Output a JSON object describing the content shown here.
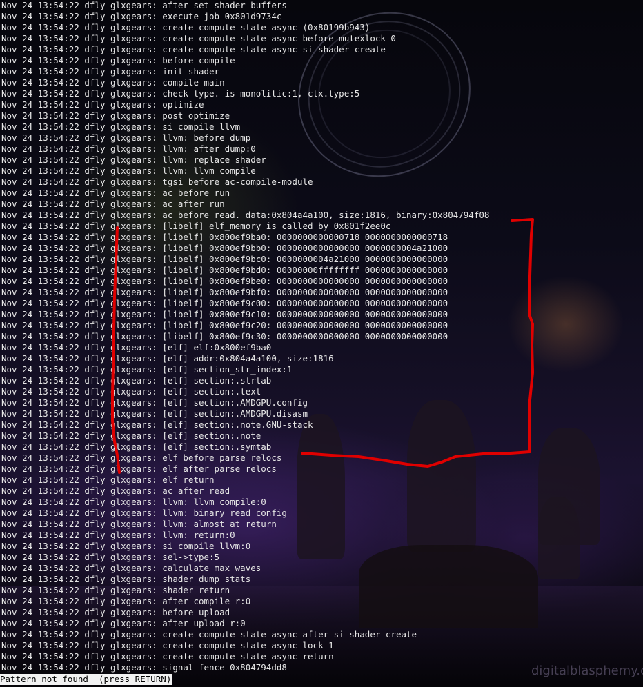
{
  "terminal": {
    "lines": [
      "Nov 24 13:54:22 dfly glxgears: after set_shader_buffers",
      "Nov 24 13:54:22 dfly glxgears: execute job 0x801d9734c",
      "Nov 24 13:54:22 dfly glxgears: create_compute_state_async (0x80199b943)",
      "Nov 24 13:54:22 dfly glxgears: create_compute_state_async before mutexlock-0",
      "Nov 24 13:54:22 dfly glxgears: create_compute_state_async si_shader_create",
      "Nov 24 13:54:22 dfly glxgears: before compile",
      "Nov 24 13:54:22 dfly glxgears: init shader",
      "Nov 24 13:54:22 dfly glxgears: compile main",
      "Nov 24 13:54:22 dfly glxgears: check type. is monolitic:1, ctx.type:5",
      "Nov 24 13:54:22 dfly glxgears: optimize",
      "Nov 24 13:54:22 dfly glxgears: post optimize",
      "Nov 24 13:54:22 dfly glxgears: si compile llvm",
      "Nov 24 13:54:22 dfly glxgears: llvm: before dump",
      "Nov 24 13:54:22 dfly glxgears: llvm: after dump:0",
      "Nov 24 13:54:22 dfly glxgears: llvm: replace shader",
      "Nov 24 13:54:22 dfly glxgears: llvm: llvm compile",
      "Nov 24 13:54:22 dfly glxgears: tgsi before ac-compile-module",
      "Nov 24 13:54:22 dfly glxgears: ac before run",
      "Nov 24 13:54:22 dfly glxgears: ac after run",
      "Nov 24 13:54:22 dfly glxgears: ac before read. data:0x804a4a100, size:1816, binary:0x804794f08",
      "Nov 24 13:54:22 dfly glxgears: [libelf] elf_memory is called by 0x801f2ee0c",
      "Nov 24 13:54:22 dfly glxgears: [libelf] 0x800ef9ba0: 0000000000000718 0000000000000718",
      "Nov 24 13:54:22 dfly glxgears: [libelf] 0x800ef9bb0: 0000000000000000 0000000004a21000",
      "Nov 24 13:54:22 dfly glxgears: [libelf] 0x800ef9bc0: 0000000004a21000 0000000000000000",
      "Nov 24 13:54:22 dfly glxgears: [libelf] 0x800ef9bd0: 00000000ffffffff 0000000000000000",
      "Nov 24 13:54:22 dfly glxgears: [libelf] 0x800ef9be0: 0000000000000000 0000000000000000",
      "Nov 24 13:54:22 dfly glxgears: [libelf] 0x800ef9bf0: 0000000000000000 0000000000000000",
      "Nov 24 13:54:22 dfly glxgears: [libelf] 0x800ef9c00: 0000000000000000 0000000000000000",
      "Nov 24 13:54:22 dfly glxgears: [libelf] 0x800ef9c10: 0000000000000000 0000000000000000",
      "Nov 24 13:54:22 dfly glxgears: [libelf] 0x800ef9c20: 0000000000000000 0000000000000000",
      "Nov 24 13:54:22 dfly glxgears: [libelf] 0x800ef9c30: 0000000000000000 0000000000000000",
      "Nov 24 13:54:22 dfly glxgears: [elf] elf:0x800ef9ba0",
      "Nov 24 13:54:22 dfly glxgears: [elf] addr:0x804a4a100, size:1816",
      "Nov 24 13:54:22 dfly glxgears: [elf] section_str_index:1",
      "Nov 24 13:54:22 dfly glxgears: [elf] section:.strtab",
      "Nov 24 13:54:22 dfly glxgears: [elf] section:.text",
      "Nov 24 13:54:22 dfly glxgears: [elf] section:.AMDGPU.config",
      "Nov 24 13:54:22 dfly glxgears: [elf] section:.AMDGPU.disasm",
      "Nov 24 13:54:22 dfly glxgears: [elf] section:.note.GNU-stack",
      "Nov 24 13:54:22 dfly glxgears: [elf] section:.note",
      "Nov 24 13:54:22 dfly glxgears: [elf] section:.symtab",
      "Nov 24 13:54:22 dfly glxgears: elf before parse relocs",
      "Nov 24 13:54:22 dfly glxgears: elf after parse relocs",
      "Nov 24 13:54:22 dfly glxgears: elf return",
      "Nov 24 13:54:22 dfly glxgears: ac after read",
      "Nov 24 13:54:22 dfly glxgears: llvm: llvm compile:0",
      "Nov 24 13:54:22 dfly glxgears: llvm: binary read config",
      "Nov 24 13:54:22 dfly glxgears: llvm: almost at return",
      "Nov 24 13:54:22 dfly glxgears: llvm: return:0",
      "Nov 24 13:54:22 dfly glxgears: si compile llvm:0",
      "Nov 24 13:54:22 dfly glxgears: sel->type:5",
      "Nov 24 13:54:22 dfly glxgears: calculate max waves",
      "Nov 24 13:54:22 dfly glxgears: shader_dump_stats",
      "Nov 24 13:54:22 dfly glxgears: shader return",
      "Nov 24 13:54:22 dfly glxgears: after compile r:0",
      "Nov 24 13:54:22 dfly glxgears: before upload",
      "Nov 24 13:54:22 dfly glxgears: after upload r:0",
      "Nov 24 13:54:22 dfly glxgears: create_compute_state_async after si_shader_create",
      "Nov 24 13:54:22 dfly glxgears: create_compute_state_async lock-1",
      "Nov 24 13:54:22 dfly glxgears: create_compute_state_async return",
      "Nov 24 13:54:22 dfly glxgears: signal fence 0x804794dd8"
    ],
    "status_prompt": "Pattern not found  (press RETURN)"
  },
  "wallpaper": {
    "watermark": "digitalblasphemy.c"
  },
  "colors": {
    "terminal_text": "#e6e6e6",
    "status_background": "#f2f2f2",
    "annotation_stroke": "#e00000"
  }
}
